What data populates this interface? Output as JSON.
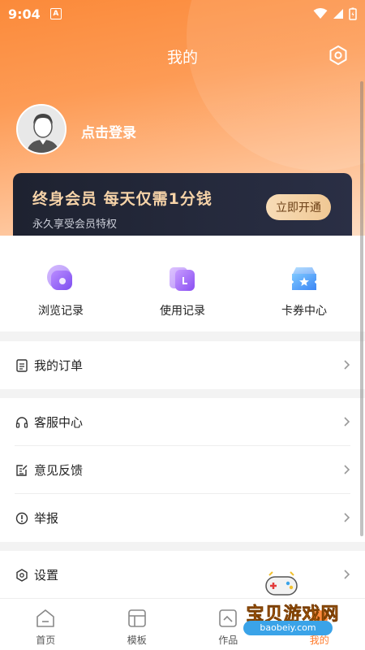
{
  "status_bar": {
    "time": "9:04",
    "notif_icon": "a-icon"
  },
  "header": {
    "title": "我的"
  },
  "profile": {
    "login_text": "点击登录"
  },
  "vip": {
    "title": "终身会员 每天仅需1分钱",
    "subtitle": "永久享受会员特权",
    "button": "立即开通"
  },
  "shortcuts": [
    {
      "label": "浏览记录",
      "icon": "history-icon"
    },
    {
      "label": "使用记录",
      "icon": "usage-record-icon"
    },
    {
      "label": "卡券中心",
      "icon": "coupon-icon"
    }
  ],
  "menu": {
    "orders": {
      "label": "我的订单",
      "icon": "document-icon"
    },
    "service": {
      "label": "客服中心",
      "icon": "headset-icon"
    },
    "feedback": {
      "label": "意见反馈",
      "icon": "edit-document-icon"
    },
    "report": {
      "label": "举报",
      "icon": "alert-circle-icon"
    },
    "settings": {
      "label": "设置",
      "icon": "gear-icon"
    }
  },
  "tabs": [
    {
      "label": "首页",
      "icon": "home-icon"
    },
    {
      "label": "模板",
      "icon": "template-icon"
    },
    {
      "label": "作品",
      "icon": "works-icon"
    },
    {
      "label": "我的",
      "icon": "profile-icon",
      "active": true
    }
  ],
  "watermark": {
    "text": "宝贝游戏网",
    "url": "baobeiy.com"
  },
  "colors": {
    "accent": "#ff7a2a",
    "vip_gold": "#f6d3a8",
    "vip_bg": "#1e2230"
  }
}
